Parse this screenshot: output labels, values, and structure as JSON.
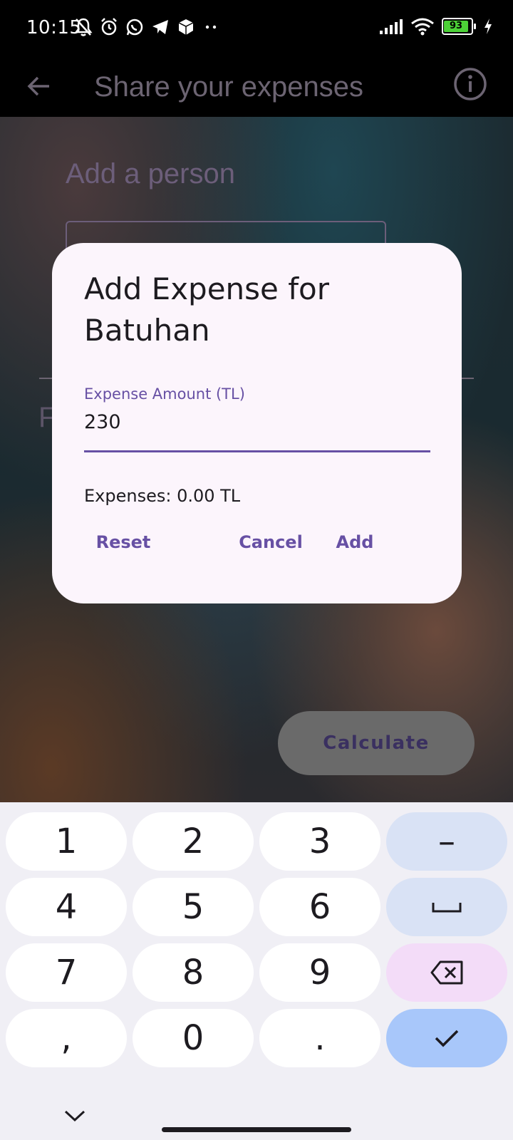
{
  "status_bar": {
    "time": "10:15",
    "battery": "93"
  },
  "app_bar": {
    "title": "Share your expenses"
  },
  "background": {
    "add_person_label": "Add a person",
    "partial_letter": "F",
    "calculate_label": "Calculate"
  },
  "dialog": {
    "title": "Add Expense for Batuhan",
    "field_label": "Expense Amount (TL)",
    "field_value": "230",
    "expenses_text": "Expenses: 0.00 TL",
    "buttons": {
      "reset": "Reset",
      "cancel": "Cancel",
      "add": "Add"
    }
  },
  "keyboard": {
    "keys": [
      "1",
      "2",
      "3",
      "–",
      "4",
      "5",
      "6",
      "7",
      "8",
      "9",
      ",",
      "0",
      "."
    ]
  },
  "colors": {
    "accent": "#6750a4",
    "dialog_bg": "#fcf5fc",
    "battery": "#4cd137",
    "enter_key": "#a8c7fa"
  }
}
